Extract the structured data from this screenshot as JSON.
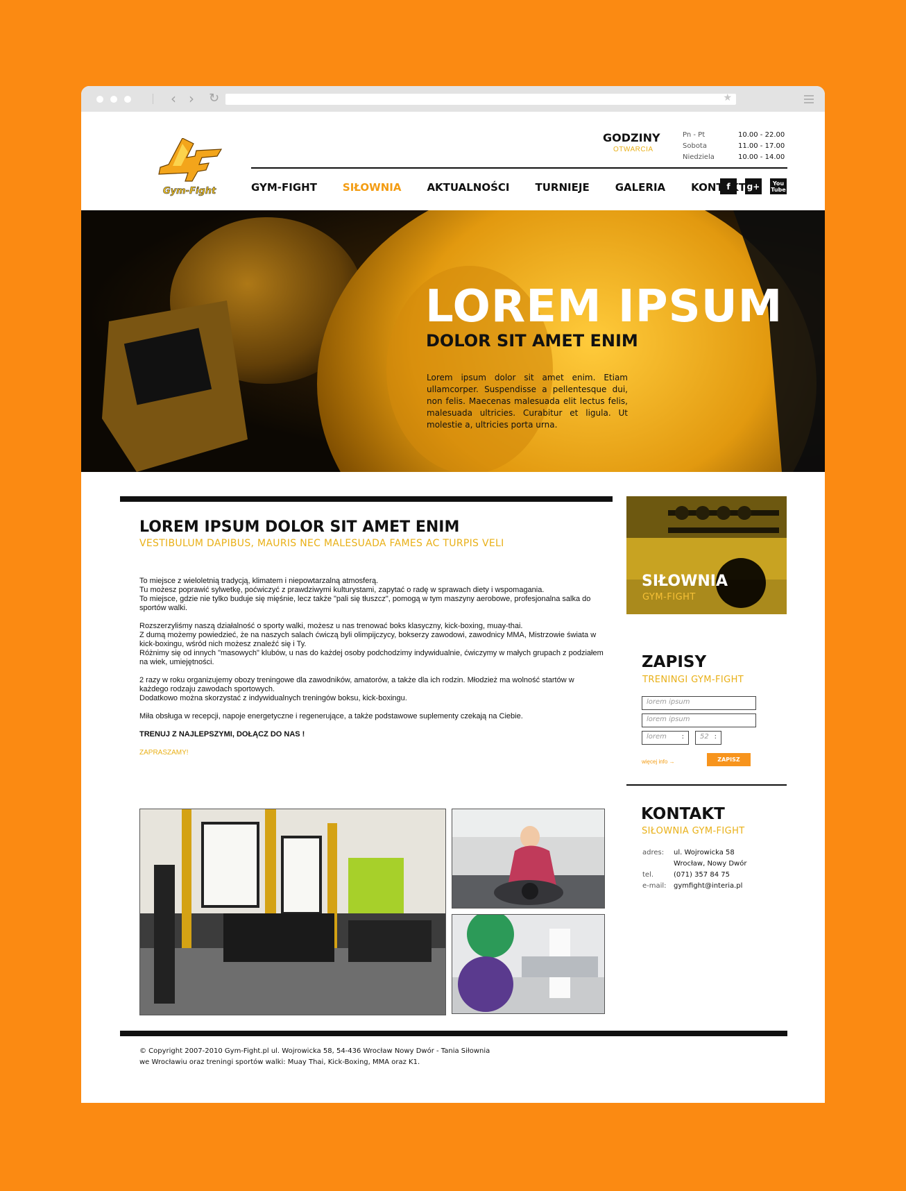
{
  "brand": {
    "logo_text": "Gym-Fight",
    "accent": "#f39c12",
    "yellow": "#e9b017",
    "background": "#fb8a12"
  },
  "hours": {
    "title": "GODZINY",
    "subtitle": "OTWARCIA",
    "rows": [
      {
        "day": "Pn - Pt",
        "time": "10.00 - 22.00"
      },
      {
        "day": "Sobota",
        "time": "11.00 - 17.00"
      },
      {
        "day": "Niedziela",
        "time": "10.00 - 14.00"
      }
    ]
  },
  "nav": {
    "items": [
      {
        "label": "GYM-FIGHT"
      },
      {
        "label": "SIŁOWNIA"
      },
      {
        "label": "AKTUALNOŚCI"
      },
      {
        "label": "TURNIEJE"
      },
      {
        "label": "GALERIA"
      },
      {
        "label": "KONTAKT"
      }
    ],
    "active": "SIŁOWNIA"
  },
  "social": {
    "facebook": "f",
    "google_plus": "g+",
    "youtube": "You Tube"
  },
  "hero": {
    "title": "LOREM IPSUM",
    "subtitle": "DOLOR SIT AMET ENIM",
    "text": "Lorem ipsum dolor sit amet enim. Etiam ullamcorper. Suspendisse a pellentesque dui, non felis. Maecenas malesuada elit lectus felis, malesuada ultricies. Curabitur et ligula. Ut molestie a, ultricies porta urna."
  },
  "main": {
    "title": "LOREM IPSUM DOLOR SIT AMET ENIM",
    "subtitle": "VESTIBULUM DAPIBUS, MAURIS NEC MALESUADA FAMES AC TURPIS VELI",
    "paragraphs": [
      "To miejsce z wieloletnią tradycją, klimatem i niepowtarzalną atmosferą.\nTu możesz poprawić sylwetkę, poćwiczyć z prawdziwymi kulturystami, zapytać o radę w sprawach diety i wspomagania.\nTo miejsce, gdzie nie tylko buduje się mięśnie, lecz także \"pali się tłuszcz\", pomogą w tym maszyny aerobowe, profesjonalna salka do sportów walki.",
      "Rozszerzyliśmy naszą działalność o sporty walki, możesz u nas trenować boks klasyczny, kick-boxing, muay-thai.\nZ dumą możemy powiedzieć, że na naszych salach ćwiczą byli olimpijczycy, bokserzy zawodowi, zawodnicy MMA, Mistrzowie świata w kick-boxingu, wśród nich możesz znaleźć się i Ty.\nRóżnimy się od innych \"masowych\" klubów, u nas do każdej osoby podchodzimy indywidualnie, ćwiczymy w małych grupach z podziałem na wiek, umiejętności.",
      "2 razy w roku organizujemy obozy treningowe dla zawodników, amatorów, a także dla ich rodzin. Młodzież ma wolność startów w każdego rodzaju zawodach sportowych.\nDodatkowo można skorzystać z indywidualnych treningów boksu, kick-boxingu.",
      "Miła obsługa w recepcji, napoje energetyczne i regenerujące, a także podstawowe suplementy czekają na Ciebie."
    ],
    "cta_bold": "TRENUJ Z NAJLEPSZYMI, DOŁĄCZ DO NAS !",
    "cta_accent": "ZAPRASZAMY!"
  },
  "sidebar": {
    "promo": {
      "title": "SIŁOWNIA",
      "subtitle": "GYM-FIGHT"
    },
    "signup": {
      "title": "ZAPISY",
      "subtitle": "TRENINGI GYM-FIGHT",
      "field1_placeholder": "lorem ipsum",
      "field2_placeholder": "lorem ipsum",
      "select1": "lorem",
      "select2": "52",
      "more_link": "więcej info →",
      "submit": "ZAPISZ"
    },
    "contact": {
      "title": "KONTAKT",
      "subtitle": "SIŁOWNIA GYM-FIGHT",
      "address_label": "adres:",
      "address_line1": "ul. Wojrowicka 58",
      "address_line2": "Wrocław, Nowy Dwór",
      "phone_label": "tel.",
      "phone": "(071) 357 84 75",
      "email_label": "e-mail:",
      "email": "gymfight@interia.pl"
    }
  },
  "footer": {
    "line1": "© Copyright 2007-2010 Gym-Fight.pl ul. Wojrowicka 58, 54-436 Wrocław Nowy Dwór - Tania Siłownia",
    "line2": "we Wrocławiu oraz treningi sportów walki: Muay Thai, Kick-Boxing, MMA oraz K1."
  }
}
